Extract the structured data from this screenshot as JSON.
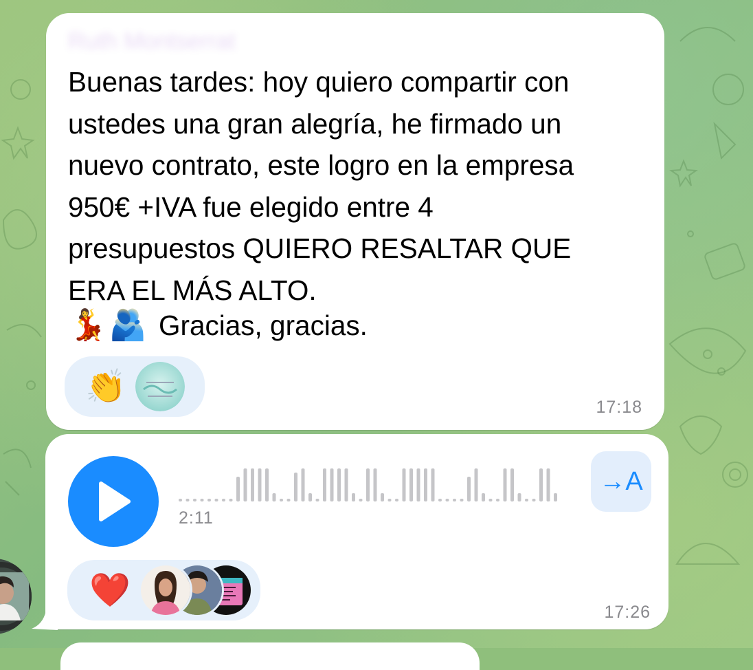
{
  "chat": {
    "message1": {
      "sender": "Ruth Montserrat",
      "text": "Buenas tardes: hoy quiero compartir con\nustedes una gran alegría, he firmado un\nnuevo contrato, este logro en la empresa\n950€ +IVA   fue elegido entre 4\npresupuestos QUIERO RESALTAR QUE\nERA EL MÁS ALTO.",
      "emojis": [
        "💃",
        "🫂"
      ],
      "closing": "Gracias, gracias.",
      "reaction_emoji": "👏",
      "reaction_avatar_icon": "reaction-avatar-icon",
      "time": "17:18"
    },
    "message2": {
      "type": "voice",
      "duration": "2:11",
      "transcribe_label": "→A",
      "reaction_emoji": "❤️",
      "reaction_count_avatars": 3,
      "time": "17:26"
    }
  },
  "colors": {
    "accent": "#1a8cff",
    "bubble": "#ffffff",
    "reaction_bg": "#e6f0fb",
    "meta": "#8a8a8e",
    "wallpaper": "#8fbf7c"
  }
}
